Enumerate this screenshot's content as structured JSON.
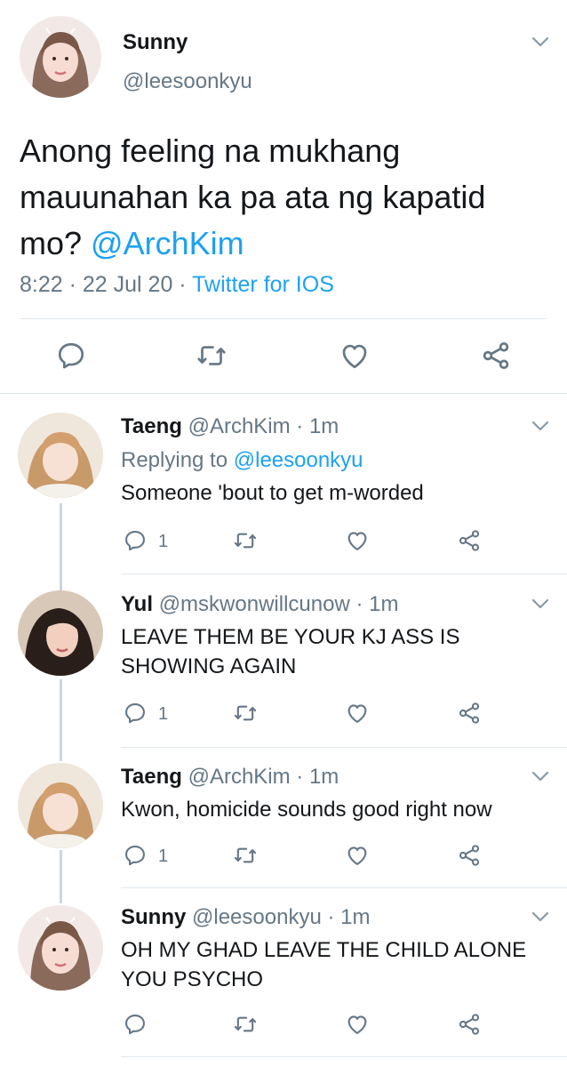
{
  "main_tweet": {
    "name": "Sunny",
    "handle": "@leesoonkyu",
    "text_before_mention": "Anong feeling na mukhang mauunahan ka pa ata ng kapatid mo? ",
    "mention": "@ArchKim",
    "time": "8:22",
    "date": "22 Jul 20",
    "source": "Twitter for IOS",
    "sep": " · "
  },
  "replies": [
    {
      "name": "Taeng",
      "handle": "@ArchKim",
      "time": "1m",
      "replying_prefix": "Replying to ",
      "replying_to": "@leesoonkyu",
      "text": "Someone 'bout to get m-worded",
      "reply_count": "1"
    },
    {
      "name": "Yul",
      "handle": "@mskwonwillcunow",
      "time": "1m",
      "text_line1": "LEAVE THEM BE YOUR KJ ASS IS",
      "text_line2": "SHOWING AGAIN",
      "reply_count": "1"
    },
    {
      "name": "Taeng",
      "handle": "@ArchKim",
      "time": "1m",
      "text": "Kwon, homicide sounds good right now",
      "reply_count": "1"
    },
    {
      "name": "Sunny",
      "handle": "@leesoonkyu",
      "time": "1m",
      "text_line1": "OH MY GHAD LEAVE THE CHILD ALONE",
      "text_line2": "YOU PSYCHO"
    }
  ],
  "colors": {
    "link": "#1da1f2",
    "secondary_text": "#657786",
    "divider": "#e1e8ed",
    "icon": "#657786"
  },
  "icons": [
    "reply-icon",
    "retweet-icon",
    "like-icon",
    "share-icon",
    "chevron-down-icon"
  ]
}
